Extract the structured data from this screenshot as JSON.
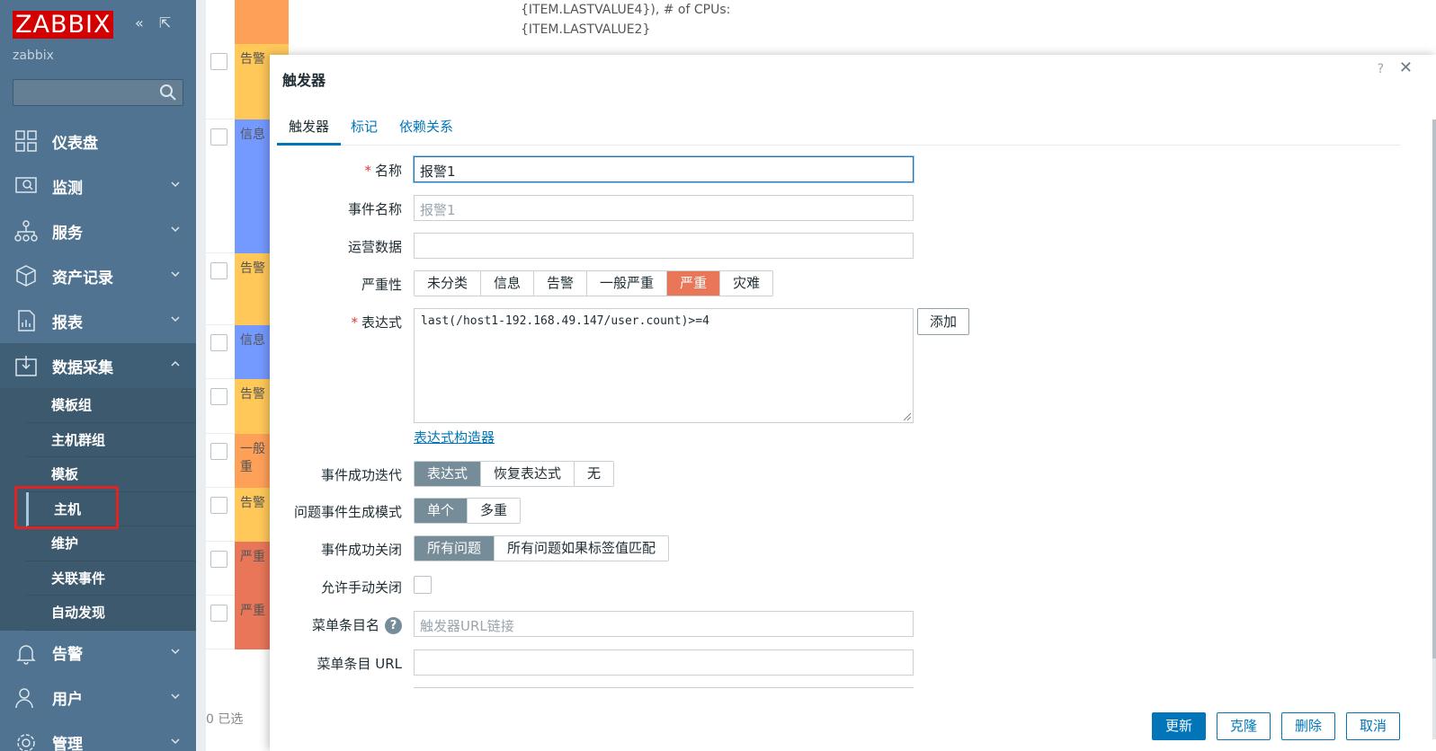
{
  "app": {
    "logo": "ZABBIX",
    "server": "zabbix",
    "collapse_icon": "double-chevron-left",
    "expand_icon": "popout-icon"
  },
  "sidebar": {
    "items": [
      {
        "label": "仪表盘",
        "icon": "dashboard-icon"
      },
      {
        "label": "监测",
        "icon": "monitoring-icon"
      },
      {
        "label": "服务",
        "icon": "services-icon"
      },
      {
        "label": "资产记录",
        "icon": "inventory-icon"
      },
      {
        "label": "报表",
        "icon": "reports-icon"
      },
      {
        "label": "数据采集",
        "icon": "data-collection-icon",
        "open": true
      },
      {
        "label": "告警",
        "icon": "bell-icon"
      },
      {
        "label": "用户",
        "icon": "users-icon"
      },
      {
        "label": "管理",
        "icon": "gear-icon"
      }
    ],
    "subitems": [
      "模板组",
      "主机群组",
      "模板",
      "主机",
      "维护",
      "关联事件",
      "自动发现"
    ],
    "active_subitem": "主机"
  },
  "background": {
    "text_line1": "{ITEM.LASTVALUE4}), # of CPUs:",
    "text_line2": "{ITEM.LASTVALUE2}",
    "rows": [
      {
        "sev": "告警",
        "color": "#ffc859"
      },
      {
        "sev": "信息",
        "color": "#7499ff"
      },
      {
        "sev": "告警",
        "color": "#ffc859"
      },
      {
        "sev": "信息",
        "color": "#7499ff"
      },
      {
        "sev": "告警",
        "color": "#ffc859"
      },
      {
        "sev": "一般",
        "sev2": "重",
        "color": "#ffa059"
      },
      {
        "sev": "告警",
        "color": "#ffc859"
      },
      {
        "sev": "严重",
        "color": "#e97659"
      },
      {
        "sev": "严重",
        "color": "#e97659"
      }
    ],
    "selected": "0 已选"
  },
  "dialog": {
    "title": "触发器",
    "help": "?",
    "close": "✕",
    "tabs": [
      "触发器",
      "标记",
      "依赖关系"
    ],
    "fields": {
      "name_label": "名称",
      "name_value": "报警1",
      "event_name_label": "事件名称",
      "event_name_placeholder": "报警1",
      "opdata_label": "运营数据",
      "opdata_value": "",
      "severity_label": "严重性",
      "severity_options": [
        "未分类",
        "信息",
        "告警",
        "一般严重",
        "严重",
        "灾难"
      ],
      "severity_selected": "严重",
      "expression_label": "表达式",
      "expression_value": "last(/host1-192.168.49.147/user.count)>=4",
      "add_button": "添加",
      "expression_builder_link": "表达式构造器",
      "ok_event_label": "事件成功迭代",
      "ok_event_options": [
        "表达式",
        "恢复表达式",
        "无"
      ],
      "ok_event_selected": "表达式",
      "problem_mode_label": "问题事件生成模式",
      "problem_mode_options": [
        "单个",
        "多重"
      ],
      "problem_mode_selected": "单个",
      "ok_close_label": "事件成功关闭",
      "ok_close_options": [
        "所有问题",
        "所有问题如果标签值匹配"
      ],
      "ok_close_selected": "所有问题",
      "manual_close_label": "允许手动关闭",
      "menu_name_label": "菜单条目名",
      "menu_name_placeholder": "触发器URL链接",
      "menu_url_label": "菜单条目 URL",
      "menu_url_value": ""
    },
    "buttons": {
      "update": "更新",
      "clone": "克隆",
      "delete": "删除",
      "cancel": "取消"
    }
  }
}
